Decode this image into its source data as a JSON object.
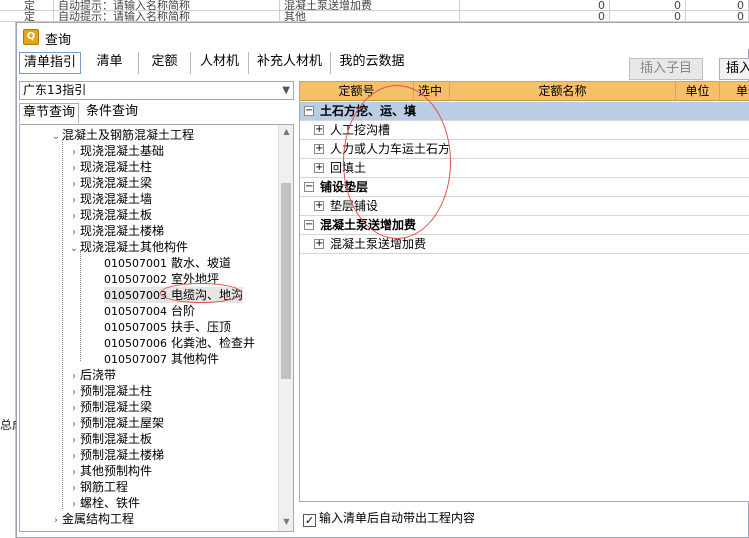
{
  "background": {
    "rows": [
      {
        "col1": "定",
        "col2": "自动提示：请输入名称简称",
        "col3": "混凝土泵送增加费",
        "v1": "0",
        "v2": "0",
        "v3": "0"
      },
      {
        "col1": "定",
        "col2": "自动提示：请输入名称简称",
        "col3": "其他",
        "v1": "0",
        "v2": "0",
        "v3": "0"
      }
    ],
    "left_text": "总成"
  },
  "dialog": {
    "title": "查询",
    "tabs": [
      "清单指引",
      "清单",
      "定额",
      "人材机",
      "补充人材机",
      "我的云数据"
    ],
    "active_tab": "清单指引",
    "insert_sub_button": "插入子目",
    "insert_button": "插入"
  },
  "left": {
    "combo_value": "广东13指引",
    "subtabs": [
      "章节查询",
      "条件查询"
    ],
    "active_subtab": "章节查询",
    "tree": [
      {
        "label": "混凝土及钢筋混凝土工程",
        "level": 0,
        "state": "expanded"
      },
      {
        "label": "现浇混凝土基础",
        "level": 1,
        "state": "collapsed"
      },
      {
        "label": "现浇混凝土柱",
        "level": 1,
        "state": "collapsed"
      },
      {
        "label": "现浇混凝土梁",
        "level": 1,
        "state": "collapsed"
      },
      {
        "label": "现浇混凝土墙",
        "level": 1,
        "state": "collapsed"
      },
      {
        "label": "现浇混凝土板",
        "level": 1,
        "state": "collapsed"
      },
      {
        "label": "现浇混凝土楼梯",
        "level": 1,
        "state": "collapsed"
      },
      {
        "label": "现浇混凝土其他构件",
        "level": 1,
        "state": "expanded"
      },
      {
        "code": "010507001",
        "label": "散水、坡道",
        "level": 2
      },
      {
        "code": "010507002",
        "label": "室外地坪",
        "level": 2
      },
      {
        "code": "010507003",
        "label": "电缆沟、地沟",
        "level": 2,
        "selected": true
      },
      {
        "code": "010507004",
        "label": "台阶",
        "level": 2
      },
      {
        "code": "010507005",
        "label": "扶手、压顶",
        "level": 2
      },
      {
        "code": "010507006",
        "label": "化粪池、检查井",
        "level": 2
      },
      {
        "code": "010507007",
        "label": "其他构件",
        "level": 2
      },
      {
        "label": "后浇带",
        "level": 1,
        "state": "collapsed"
      },
      {
        "label": "预制混凝土柱",
        "level": 1,
        "state": "collapsed"
      },
      {
        "label": "预制混凝土梁",
        "level": 1,
        "state": "collapsed"
      },
      {
        "label": "预制混凝土屋架",
        "level": 1,
        "state": "collapsed"
      },
      {
        "label": "预制混凝土板",
        "level": 1,
        "state": "collapsed"
      },
      {
        "label": "预制混凝土楼梯",
        "level": 1,
        "state": "collapsed"
      },
      {
        "label": "其他预制构件",
        "level": 1,
        "state": "collapsed"
      },
      {
        "label": "钢筋工程",
        "level": 1,
        "state": "collapsed"
      },
      {
        "label": "螺栓、铁件",
        "level": 1,
        "state": "collapsed"
      },
      {
        "label": "金属结构工程",
        "level": 0,
        "state": "collapsed"
      }
    ]
  },
  "grid": {
    "columns": [
      "定额号",
      "选中",
      "定额名称",
      "单位",
      "单价"
    ],
    "rows": [
      {
        "type": "group",
        "label": "土石方挖、运、填",
        "toggle": "−"
      },
      {
        "type": "item",
        "label": "人工挖沟槽",
        "toggle": "+"
      },
      {
        "type": "item",
        "label": "人力或人力车运土石方",
        "toggle": "+"
      },
      {
        "type": "item",
        "label": "回填土",
        "toggle": "+"
      },
      {
        "type": "group",
        "label": "铺设垫层",
        "toggle": "−"
      },
      {
        "type": "item",
        "label": "垫层铺设",
        "toggle": "+"
      },
      {
        "type": "group",
        "label": "混凝土泵送增加费",
        "toggle": "−"
      },
      {
        "type": "item",
        "label": "混凝土泵送增加费",
        "toggle": "+"
      }
    ]
  },
  "footer": {
    "auto_bring_checkbox_label": "输入清单后自动带出工程内容",
    "auto_bring_checked": true
  }
}
